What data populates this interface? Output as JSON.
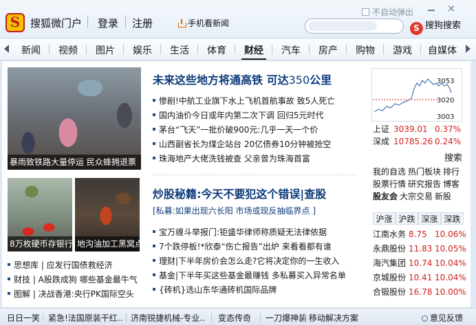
{
  "header": {
    "logo_letter": "S",
    "title": "搜狐微门户",
    "login": "登录",
    "register": "注册",
    "mobile": "手机看新闻",
    "no_popup": "不自动弹出",
    "close": "×",
    "search_button": "搜狗搜索"
  },
  "nav": {
    "items": [
      "新闻",
      "视频",
      "图片",
      "娱乐",
      "生活",
      "体育",
      "财经",
      "汽车",
      "房产",
      "购物",
      "游戏",
      "自媒体"
    ],
    "active": "财经"
  },
  "photos": [
    {
      "caption": "暴雨致铁路大量停运 民众蜂拥退票"
    },
    {
      "caption": "8万枚硬币存银行"
    },
    {
      "caption": "地沟油加工黑窝点遭突袭"
    }
  ],
  "feature_links": [
    "思想库 | 应发行国债救经济",
    "财技 | A股跌成狗 哪些基金最牛气",
    "图解 | 决战香港:央行PK国际空头"
  ],
  "main": {
    "headline1_text": "未来这些地方将通高铁 可达",
    "headline1_num": "350",
    "headline1_unit": "公里",
    "news1": [
      "惨剧!中航工业旗下水上飞机首航事故 致5人死亡",
      "国内油价今日或年内第二次下调 回归5元时代",
      "茅台“飞天”一批价破900元:几乎一天一个价",
      "山西副省长为煤企站台 20亿债券10分钟被抢空",
      "珠海地产大佬洗钱被查 父亲曾为珠海首富"
    ],
    "headline2": "炒股秘籍:今天不要犯这个错误|查股",
    "subhead2": "[私募:如果出现六长阳 市场或现反抽临界点 ]",
    "news2": [
      "宝万缠斗举报门:钜盛华律师称质疑无法律依据",
      "7个跌停板!*欣泰“伤亡报告”出炉 来看看都有谁",
      "理财|下半年房价会怎么走?它将决定你的一生收入",
      "基金|下半年买这些基金最赚钱 多私募买入异常名单",
      "{砖机}选山东华通砖机国际品牌"
    ]
  },
  "market": {
    "chart_labels": [
      "3053",
      "3020",
      "3003"
    ],
    "indices": [
      {
        "name": "上证",
        "value": "3039.01",
        "change": "0.37%"
      },
      {
        "name": "深成",
        "value": "10785.26",
        "change": "0.24%"
      }
    ],
    "search_label": "搜索",
    "links_row1": [
      "我的自选",
      "热门板块",
      "排行"
    ],
    "links_row2": [
      "股票行情",
      "研究报告",
      "博客"
    ],
    "links_row3": [
      "股友会",
      "大宗交易",
      "新股"
    ],
    "tabs": [
      "沪涨",
      "沪跌",
      "深涨",
      "深跌"
    ],
    "stocks": [
      {
        "name": "江南水务",
        "price": "8.75",
        "change": "10.06%"
      },
      {
        "name": "永鼎股份",
        "price": "11.83",
        "change": "10.05%"
      },
      {
        "name": "海汽集团",
        "price": "10.74",
        "change": "10.04%"
      },
      {
        "name": "京城股份",
        "price": "10.41",
        "change": "10.04%"
      },
      {
        "name": "合锻股份",
        "price": "16.78",
        "change": "10.00%"
      }
    ],
    "up_color": "#d0211a"
  },
  "footer": {
    "items": [
      "日日一笑",
      "紧急!法国原装干红..",
      "济南锐捷机械-专业..",
      "变态传奇",
      "一刀爆神装",
      "移动解决方案"
    ],
    "feedback": "意见反馈"
  }
}
